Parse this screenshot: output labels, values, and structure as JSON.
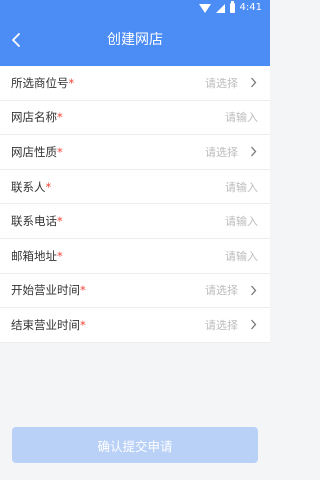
{
  "status": {
    "time": "4:41"
  },
  "header": {
    "title": "创建网店"
  },
  "fields": [
    {
      "label": "所选商位号",
      "required_mark": "*",
      "value": "请选择"
    },
    {
      "label": "网店名称",
      "required_mark": "*",
      "value": "请输入"
    },
    {
      "label": "网店性质",
      "required_mark": "*",
      "value": "请选择"
    },
    {
      "label": "联系人",
      "required_mark": "*",
      "value": "请输入"
    },
    {
      "label": "联系电话",
      "required_mark": "*",
      "value": "请输入"
    },
    {
      "label": "邮箱地址",
      "required_mark": "*",
      "value": "请输入"
    },
    {
      "label": "开始营业时间",
      "required_mark": "*",
      "value": "请选择"
    },
    {
      "label": "结束营业时间",
      "required_mark": "*",
      "value": "请选择"
    }
  ],
  "submit": {
    "label": "确认提交申请"
  },
  "colors": {
    "accent": "#4c8cf5",
    "required": "#f04438",
    "button_disabled": "#b9d0f7"
  }
}
